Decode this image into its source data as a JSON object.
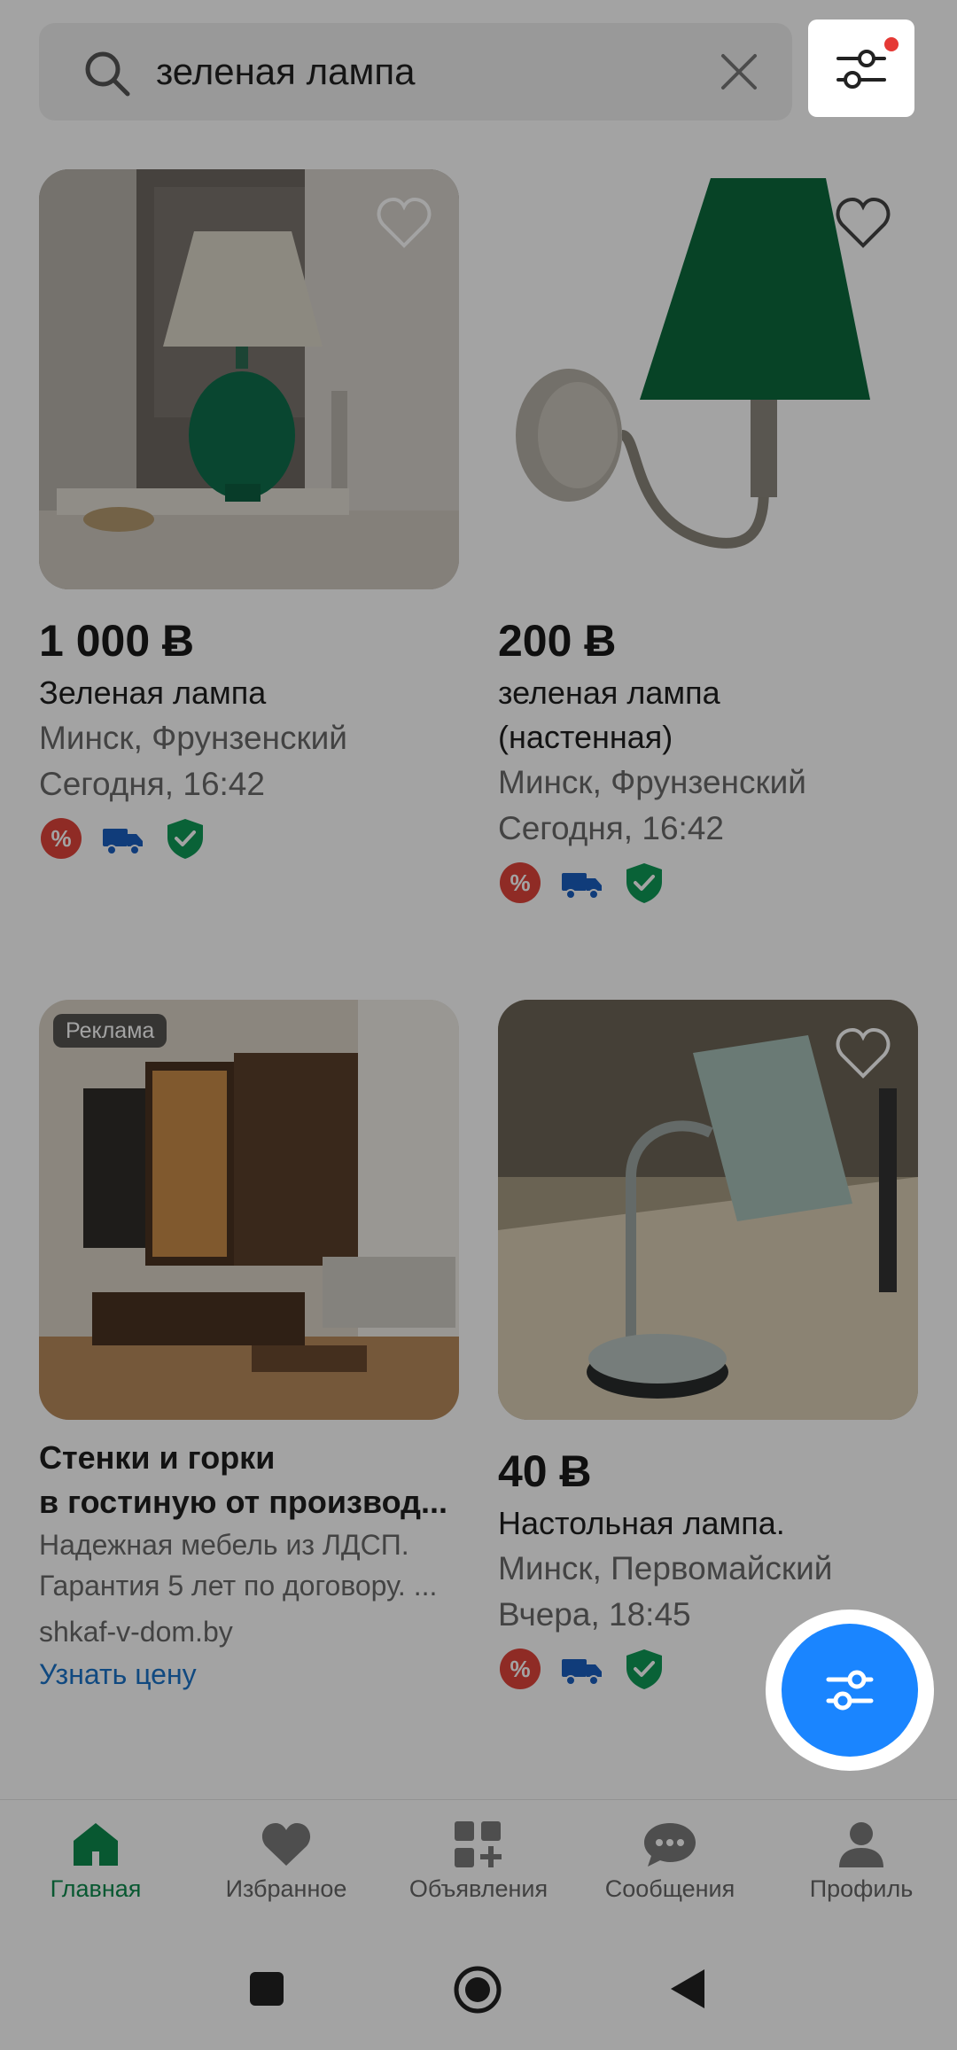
{
  "search": {
    "query": "зеленая лампа",
    "search_icon": "search-icon",
    "clear_icon": "close-icon",
    "filter_icon": "sliders-icon"
  },
  "listings": [
    {
      "price": "1 000 Ƀ",
      "title": "Зеленая лампа",
      "location": "Минск, Фрунзенский",
      "date": "Сегодня, 16:42",
      "badges": [
        "discount-icon",
        "delivery-icon",
        "verified-icon"
      ]
    },
    {
      "price": "200 Ƀ",
      "title": "зеленая лампа (настенная)",
      "location": "Минск, Фрунзенский",
      "date": "Сегодня, 16:42",
      "badges": [
        "discount-icon",
        "delivery-icon",
        "verified-icon"
      ]
    },
    {
      "price": "40 Ƀ",
      "title": "Настольная лампа.",
      "location": "Минск, Первомайский",
      "date": "Вчера, 18:45",
      "badges": [
        "discount-icon",
        "delivery-icon",
        "verified-icon"
      ]
    }
  ],
  "ad": {
    "label": "Реклама",
    "title_line1": "Стенки и горки",
    "title_line2": "в гостиную от производ...",
    "desc_line1": "Надежная мебель из ЛДСП.",
    "desc_line2": "Гарантия 5 лет по договору. ...",
    "domain": "shkaf-v-dom.by",
    "cta": "Узнать цену"
  },
  "nav": {
    "items": [
      {
        "label": "Главная",
        "icon": "home-icon"
      },
      {
        "label": "Избранное",
        "icon": "heart-icon"
      },
      {
        "label": "Объявления",
        "icon": "grid-plus-icon"
      },
      {
        "label": "Сообщения",
        "icon": "chat-icon"
      },
      {
        "label": "Профиль",
        "icon": "user-icon"
      }
    ]
  },
  "colors": {
    "brand_green": "#0e8a4e",
    "fab_blue": "#1a85ff",
    "link_blue": "#1a73c8",
    "notification_red": "#e53935"
  }
}
